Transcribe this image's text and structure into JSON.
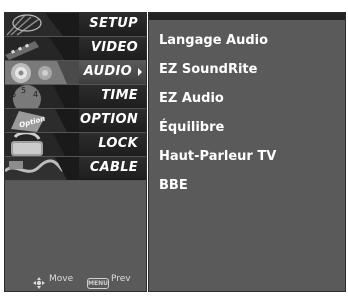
{
  "menu": {
    "items": [
      {
        "id": "setup",
        "label": "SETUP",
        "icon": "satellite-dish-icon",
        "active": false
      },
      {
        "id": "video",
        "label": "VIDEO",
        "icon": "film-strip-icon",
        "active": false
      },
      {
        "id": "audio",
        "label": "AUDIO",
        "icon": "speaker-icon",
        "active": true
      },
      {
        "id": "time",
        "label": "TIME",
        "icon": "clock-icon",
        "active": false
      },
      {
        "id": "option",
        "label": "OPTION",
        "icon": "option-tag-icon",
        "active": false
      },
      {
        "id": "lock",
        "label": "LOCK",
        "icon": "padlock-icon",
        "active": false
      },
      {
        "id": "cable",
        "label": "CABLE",
        "icon": "cable-icon",
        "active": false
      }
    ],
    "footer": {
      "move_label": "Move",
      "menu_key": "MENU",
      "prev_label": "Prev"
    }
  },
  "submenu": {
    "items": [
      {
        "label": "Langage Audio"
      },
      {
        "label": "EZ SoundRite"
      },
      {
        "label": "EZ Audio"
      },
      {
        "label": "Équilibre"
      },
      {
        "label": "Haut-Parleur TV"
      },
      {
        "label": "BBE"
      }
    ]
  },
  "colors": {
    "panel_bg": "#5a5a5a",
    "item_bg": "#1f1f1f",
    "active_bg": "#4a4a4a",
    "text": "#ffffff"
  }
}
